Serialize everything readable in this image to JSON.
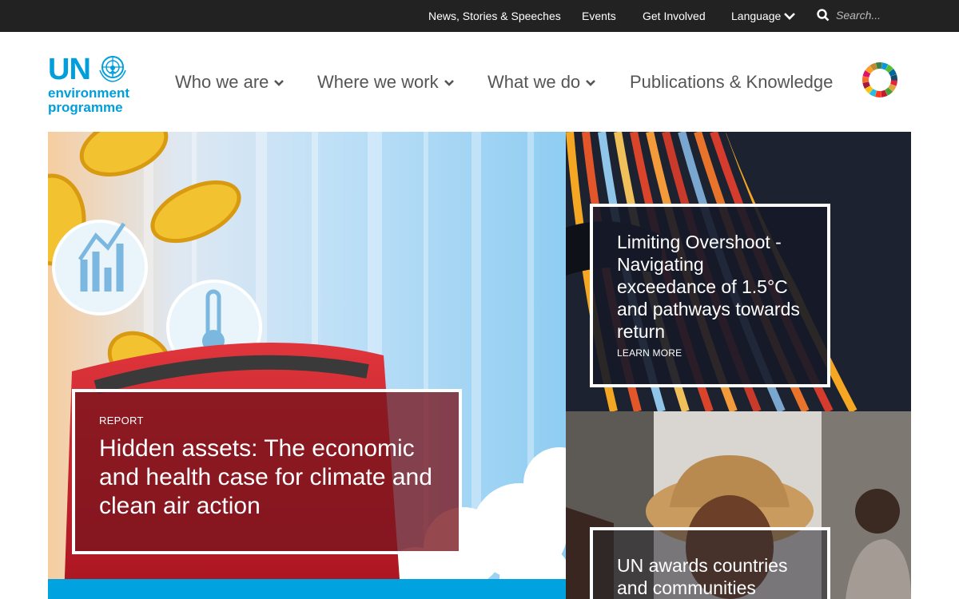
{
  "topbar": {
    "links": [
      "News, Stories & Speeches",
      "Events",
      "Get Involved"
    ],
    "language_label": "Language",
    "search_placeholder": "Search..."
  },
  "logo": {
    "un": "UN",
    "line2": "environment",
    "line3": "programme"
  },
  "nav": {
    "items": [
      "Who we are",
      "Where we work",
      "What we do",
      "Publications & Knowledge"
    ]
  },
  "hero": {
    "kicker": "REPORT",
    "title": "Hidden assets: The economic and health case for climate and clean air action"
  },
  "feature1": {
    "title": "Limiting Overshoot - Navigating exceedance of 1.5°C and pathways towards return",
    "link": "LEARN MORE"
  },
  "feature2": {
    "title": "UN awards countries and communities"
  },
  "colors": {
    "brand_blue": "#009edb",
    "topbar": "#222222",
    "hero_card": "#78141e"
  }
}
